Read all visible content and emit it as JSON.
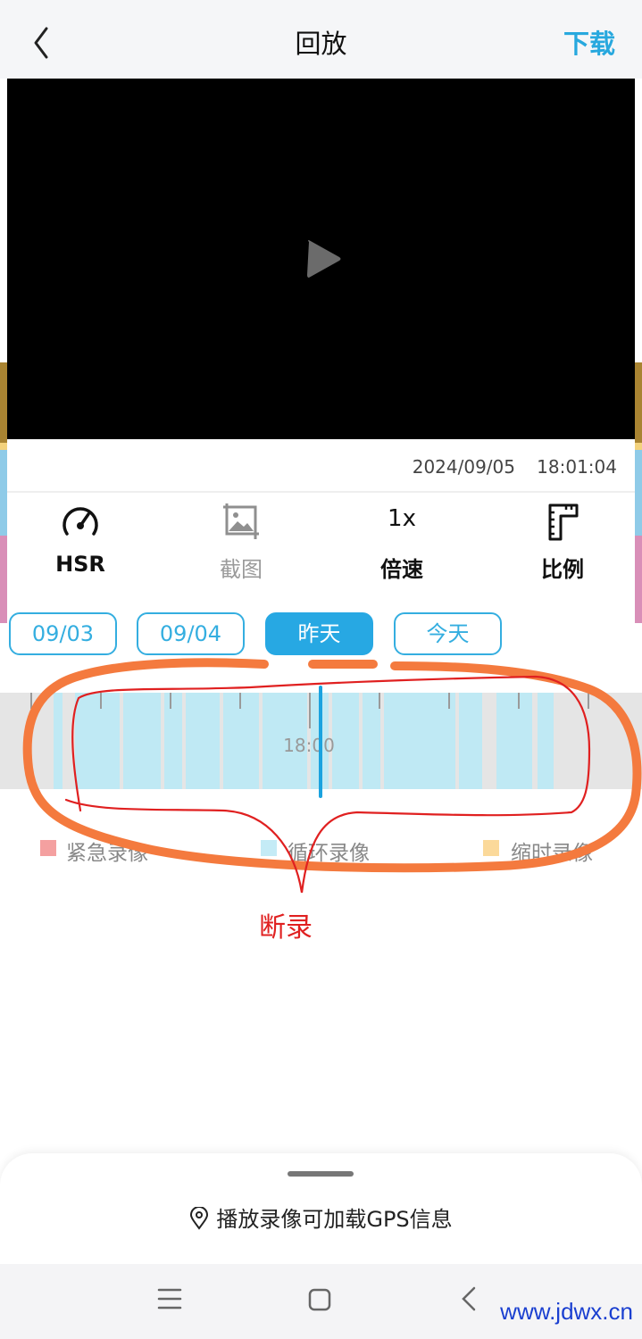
{
  "header": {
    "title": "回放",
    "download_label": "下载"
  },
  "player": {
    "date": "2024/09/05",
    "time": "18:01:04"
  },
  "toolbar": {
    "hsr_label": "HSR",
    "screenshot_label": "截图",
    "speed_value": "1x",
    "speed_label": "倍速",
    "ratio_label": "比例"
  },
  "date_tabs": [
    {
      "label": "09/03",
      "active": false
    },
    {
      "label": "09/04",
      "active": false
    },
    {
      "label": "昨天",
      "active": true
    },
    {
      "label": "今天",
      "active": false
    }
  ],
  "timeline": {
    "time_label": "18:00"
  },
  "legend": [
    {
      "label": "紧急录像",
      "color": "#f4a0a0"
    },
    {
      "label": "循环录像",
      "color": "#c4ebf6"
    },
    {
      "label": "缩时录像",
      "color": "#fbd99a"
    }
  ],
  "annotation": {
    "label": "断录",
    "color": "#e02020",
    "stroke_color": "#f47a3e"
  },
  "bottom_sheet": {
    "gps_text": "播放录像可加载GPS信息"
  },
  "watermark": "www.jdwx.cn",
  "colors": {
    "accent": "#27a8de",
    "recording": "#bfe9f4",
    "track": "#e5e5e5"
  }
}
